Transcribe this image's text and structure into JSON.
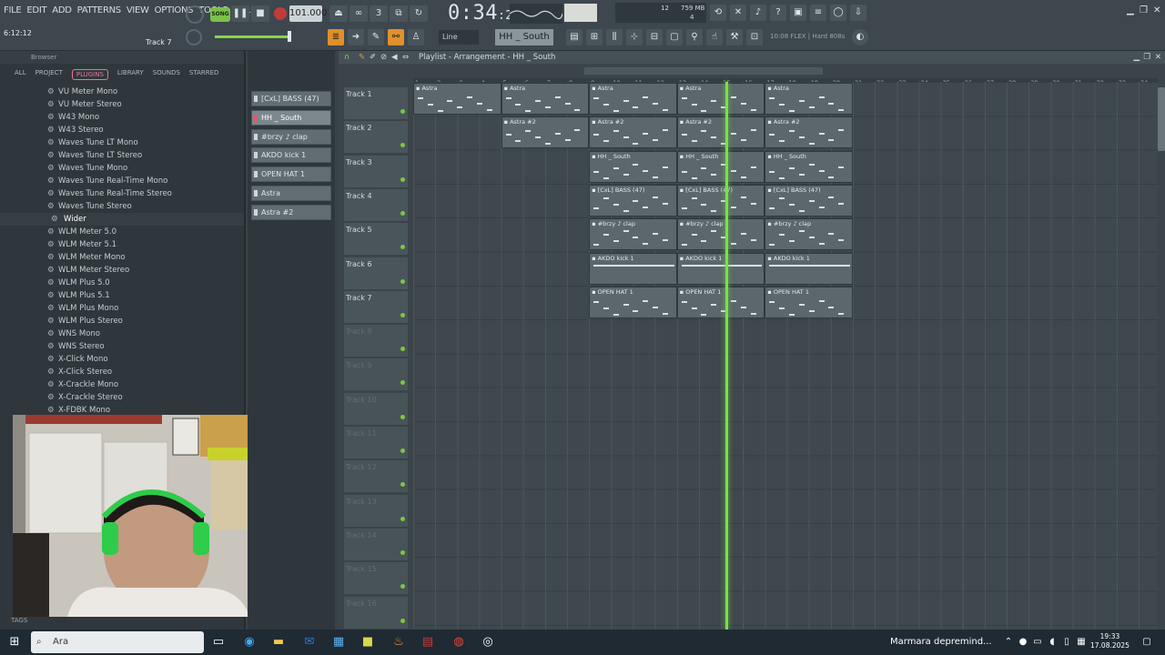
{
  "menu": [
    "FILE",
    "EDIT",
    "ADD",
    "PATTERNS",
    "VIEW",
    "OPTIONS",
    "TOOLS",
    "HELP"
  ],
  "transport": {
    "mode_label": "SONG",
    "tempo": "101.000",
    "time_main": "0:34",
    "time_sub": ":20",
    "hint_left": "6:12:12",
    "hint_right": "Track 7"
  },
  "cpu": {
    "voices": "12",
    "memory": "759 MB",
    "poly": "4"
  },
  "toolbar2": {
    "snap_mode": "Line",
    "pattern": "HH _ South",
    "flex_label": "10:08  FLEX | Hard 808s"
  },
  "browser": {
    "title": "Browser",
    "tabs": [
      "ALL",
      "PROJECT",
      "PLUGINS",
      "LIBRARY",
      "SOUNDS",
      "STARRED"
    ],
    "active_tab": "PLUGINS",
    "items": [
      "VU Meter Mono",
      "VU Meter Stereo",
      "W43 Mono",
      "W43 Stereo",
      "Waves Tune LT Mono",
      "Waves Tune LT Stereo",
      "Waves Tune Mono",
      "Waves Tune Real-Time Mono",
      "Waves Tune Real-Time Stereo",
      "Waves Tune Stereo",
      "Wider",
      "WLM Meter 5.0",
      "WLM Meter 5.1",
      "WLM Meter Mono",
      "WLM Meter Stereo",
      "WLM Plus 5.0",
      "WLM Plus 5.1",
      "WLM Plus Mono",
      "WLM Plus Stereo",
      "WNS Mono",
      "WNS Stereo",
      "X-Click Mono",
      "X-Click Stereo",
      "X-Crackle Mono",
      "X-Crackle Stereo",
      "X-FDBK Mono"
    ],
    "selected_item": "Wider",
    "tags_label": "TAGS"
  },
  "patterns": [
    "[CxL] BASS (47)",
    "HH _ South",
    "#brzy ♪ clap",
    "AKDO kick 1",
    "OPEN HAT 1",
    "Astra",
    "Astra #2"
  ],
  "active_pattern": "HH _ South",
  "playlist": {
    "title": "Playlist - Arrangement - HH _ South",
    "tracks": [
      "Track 1",
      "Track 2",
      "Track 3",
      "Track 4",
      "Track 5",
      "Track 6",
      "Track 7",
      "Track 8",
      "Track 9",
      "Track 10",
      "Track 11",
      "Track 12",
      "Track 13",
      "Track 14",
      "Track 15",
      "Track 16"
    ],
    "bars": [
      "1",
      "2",
      "3",
      "4",
      "5",
      "6",
      "7",
      "8",
      "9",
      "10",
      "11",
      "12",
      "13",
      "14",
      "15",
      "16",
      "17",
      "18",
      "19",
      "20",
      "21",
      "22",
      "23",
      "24",
      "25",
      "26",
      "27",
      "28",
      "29",
      "30",
      "31",
      "32",
      "33",
      "34"
    ],
    "playhead_bar": 15.2,
    "clips": [
      {
        "track": 1,
        "label": "Astra",
        "start": 1,
        "end": 5
      },
      {
        "track": 1,
        "label": "Astra",
        "start": 5,
        "end": 9
      },
      {
        "track": 1,
        "label": "Astra",
        "start": 9,
        "end": 13
      },
      {
        "track": 1,
        "label": "Astra",
        "start": 13,
        "end": 17
      },
      {
        "track": 1,
        "label": "Astra",
        "start": 17,
        "end": 21
      },
      {
        "track": 2,
        "label": "Astra #2",
        "start": 5,
        "end": 9
      },
      {
        "track": 2,
        "label": "Astra #2",
        "start": 9,
        "end": 13
      },
      {
        "track": 2,
        "label": "Astra #2",
        "start": 13,
        "end": 17
      },
      {
        "track": 2,
        "label": "Astra #2",
        "start": 17,
        "end": 21
      },
      {
        "track": 3,
        "label": "HH _ South",
        "start": 9,
        "end": 13
      },
      {
        "track": 3,
        "label": "HH _ South",
        "start": 13,
        "end": 17
      },
      {
        "track": 3,
        "label": "HH _ South",
        "start": 17,
        "end": 21
      },
      {
        "track": 4,
        "label": "[CxL] BASS (47)",
        "start": 9,
        "end": 13
      },
      {
        "track": 4,
        "label": "[CxL] BASS (47)",
        "start": 13,
        "end": 17
      },
      {
        "track": 4,
        "label": "[CxL] BASS (47)",
        "start": 17,
        "end": 21
      },
      {
        "track": 5,
        "label": "#brzy ♪ clap",
        "start": 9,
        "end": 13
      },
      {
        "track": 5,
        "label": "#brzy ♪ clap",
        "start": 13,
        "end": 17
      },
      {
        "track": 5,
        "label": "#brzy ♪ clap",
        "start": 17,
        "end": 21
      },
      {
        "track": 6,
        "label": "AKDO kick 1",
        "start": 9,
        "end": 13
      },
      {
        "track": 6,
        "label": "AKDO kick 1",
        "start": 13,
        "end": 17
      },
      {
        "track": 6,
        "label": "AKDO kick 1",
        "start": 17,
        "end": 21
      },
      {
        "track": 7,
        "label": "OPEN HAT 1",
        "start": 9,
        "end": 13
      },
      {
        "track": 7,
        "label": "OPEN HAT 1",
        "start": 13,
        "end": 17
      },
      {
        "track": 7,
        "label": "OPEN HAT 1",
        "start": 17,
        "end": 21
      }
    ]
  },
  "taskbar": {
    "search_placeholder": "Ara",
    "news": "Marmara depremind...",
    "time": "19:33",
    "date": "17.08.2025"
  },
  "colors": {
    "accent_green": "#7ce04a",
    "plugins_tab": "#e8739e",
    "pattern_marker": "#e05a6a"
  }
}
